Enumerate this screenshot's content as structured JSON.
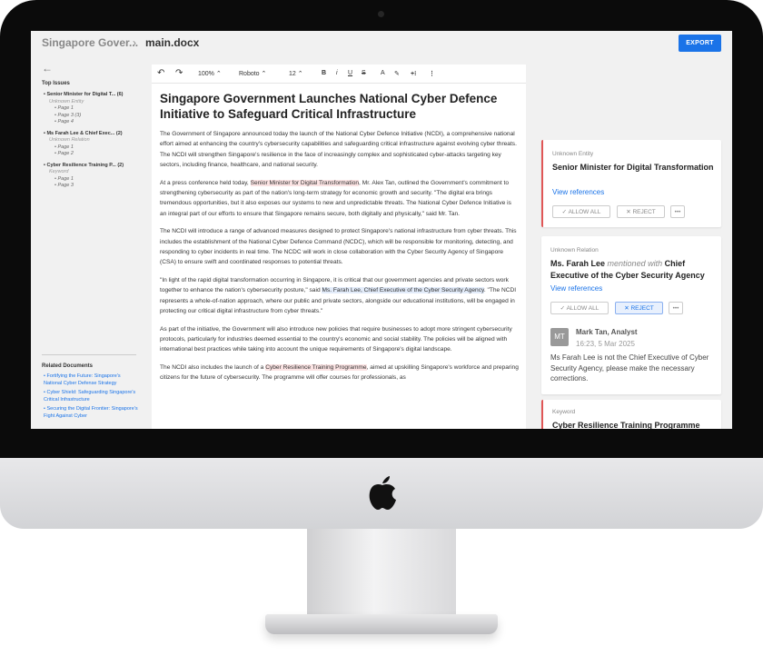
{
  "breadcrumb": {
    "project": "Singapore Gover...",
    "separator": "›",
    "file": "main.docx"
  },
  "header": {
    "export_label": "EXPORT"
  },
  "sidebar": {
    "back_icon": "arrow-left-icon",
    "heading": "Top Issues",
    "issues": [
      {
        "title": "Senior Minister for Digital T... (6)",
        "kind": "Unknown Entity",
        "pages": [
          "Page 1",
          "Page 3 (3)",
          "Page 4"
        ]
      },
      {
        "title": "Ms Farah Lee & Chief Exec... (2)",
        "kind": "Unknown Relation",
        "pages": [
          "Page 1",
          "Page 2"
        ]
      },
      {
        "title": "Cyber Resilience Training P... (2)",
        "kind": "Keyword",
        "pages": [
          "Page 1",
          "Page 3"
        ]
      }
    ],
    "related_heading": "Related Documents",
    "related": [
      "Fortifying the Future: Singapore's National Cyber Defense Strategy",
      "Cyber Shield: Safeguarding Singapore's Critical Infrastructure",
      "Securing the Digital Frontier: Singapore's Fight Against Cyber"
    ]
  },
  "toolbar": {
    "zoom": "100%",
    "font": "Roboto",
    "size": "12",
    "bold": "B",
    "italic": "i",
    "underline": "U",
    "strike": "S"
  },
  "document": {
    "title": "Singapore Government Launches National Cyber Defence Initiative to Safeguard Critical Infrastructure",
    "p1": "The Government of Singapore announced today the launch of the National Cyber Defence Initiative (NCDI), a comprehensive national effort aimed at enhancing the country's cybersecurity capabilities and safeguarding critical infrastructure against evolving cyber threats. The NCDI will strengthen Singapore's resilience in the face of increasingly complex and sophisticated cyber-attacks targeting key sectors, including finance, healthcare, and national security.",
    "p2a": "At a press conference held today, ",
    "p2h": "Senior Minister for Digital Transformation",
    "p2b": ", Mr. Alex Tan, outlined the Government's commitment to strengthening cybersecurity as part of the nation's long-term strategy for economic growth and security. \"The digital era brings tremendous opportunities, but it also exposes our systems to new and unpredictable threats. The National Cyber Defence Initiative is an integral part of our efforts to ensure that Singapore remains secure, both digitally and physically,\" said Mr. Tan.",
    "p3": "The NCDI will introduce a range of advanced measures designed to protect Singapore's national infrastructure from cyber threats. This includes the establishment of the National Cyber Defence Command (NCDC), which will be responsible for monitoring, detecting, and responding to cyber incidents in real time. The NCDC will work in close collaboration with the Cyber Security Agency of Singapore (CSA) to ensure swift and coordinated responses to potential threats.",
    "p4a": "\"In light of the rapid digital transformation occurring in Singapore, it is critical that our government agencies and private sectors work together to enhance the nation's cybersecurity posture,\" said ",
    "p4h": "Ms. Farah Lee, Chief Executive of the Cyber Security Agency",
    "p4b": ". \"The NCDI represents a whole-of-nation approach, where our public and private sectors, alongside our educational institutions, will be engaged in protecting our critical digital infrastructure from cyber threats.\"",
    "p5": "As part of the initiative, the Government will also introduce new policies that require businesses to adopt more stringent cybersecurity protocols, particularly for industries deemed essential to the country's economic and social stability. The policies will be aligned with international best practices while taking into account the unique requirements of Singapore's digital landscape.",
    "p6a": "The NCDI also includes the launch of a ",
    "p6h": "Cyber Resilience Training Programme",
    "p6b": ", aimed at upskilling Singapore's workforce and preparing citizens for the future of cybersecurity. The programme will offer courses for professionals, as"
  },
  "cards": [
    {
      "type": "Unknown Entity",
      "title": "Senior Minister for Digital Transformation",
      "link": "View references",
      "allow": "ALLOW ALL",
      "reject": "REJECT",
      "more": "•••"
    },
    {
      "type": "Unknown Relation",
      "subject": "Ms. Farah Lee",
      "relation": "mentioned with",
      "object": "Chief Executive of the Cyber Security Agency",
      "link": "View references",
      "allow": "ALLOW ALL",
      "reject": "REJECT",
      "more": "•••",
      "comment": {
        "initials": "MT",
        "author": "Mark Tan, Analyst",
        "time": "16:23, 5 Mar 2025",
        "text": "Ms Farah Lee is not the Chief Executive of Cyber Security Agency, please make the necessary corrections."
      }
    },
    {
      "type": "Keyword",
      "title": "Cyber Resilience Training Programme"
    }
  ]
}
